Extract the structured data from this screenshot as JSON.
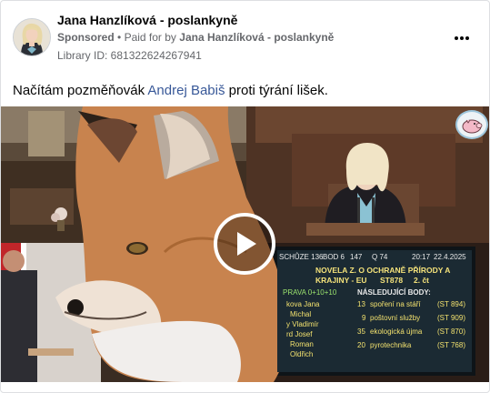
{
  "post": {
    "page_name": "Jana Hanzlíková - poslankyně",
    "sponsored": "Sponsored",
    "separator": "•",
    "paid_for_prefix": "Paid for by",
    "paid_for_name": "Jana Hanzlíková - poslankyně",
    "library_id": "Library ID: 681322624267941",
    "text_before": "Načítám pozměňovák",
    "text_link": "Andrej Babiš",
    "text_after": "proti týrání lišek.",
    "more_icon": "more-horizontal-icon",
    "play_icon": "play-icon"
  },
  "voting_board": {
    "session": "SCHŮZE 136",
    "point": "BOD 6",
    "count": "147",
    "q": "Q 74",
    "time": "20:17",
    "date": "22.4.2025",
    "title_line1": "NOVELA Z. O OCHRANĚ PŘÍRODY A",
    "title_line2": "KRAJINY - EU",
    "print_no": "ST878",
    "reading": "2. čt",
    "left_head": "PRAVA 0+10+10",
    "next_head": "NÁSLEDUJÍCÍ BODY:",
    "names": [
      "kova Jana",
      "Michal",
      "y Vladimír",
      "rd Josef",
      "Roman",
      "Oldřich"
    ],
    "next_items": [
      {
        "no": "13",
        "name": "spoření na stáří",
        "code": "(ST 894)"
      },
      {
        "no": "9",
        "name": "poštovní služby",
        "code": "(ST 909)"
      },
      {
        "no": "35",
        "name": "ekologická újma",
        "code": "(ST 870)"
      },
      {
        "no": "20",
        "name": "pyrotechnika",
        "code": "(ST 768)"
      }
    ]
  },
  "colors": {
    "link": "#385898",
    "secondary_text": "#65676b",
    "primary_text": "#050505"
  }
}
